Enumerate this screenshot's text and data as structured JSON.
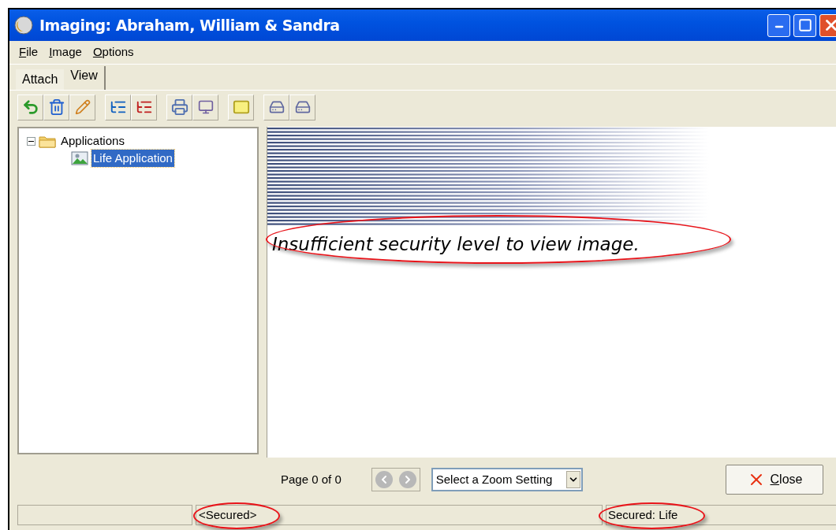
{
  "window": {
    "title": "Imaging: Abraham, William & Sandra"
  },
  "menu": [
    "File",
    "Image",
    "Options"
  ],
  "tabs": [
    {
      "label": "Attach",
      "selected": false
    },
    {
      "label": "View",
      "selected": true
    }
  ],
  "tree": [
    {
      "label": "Applications",
      "expanded": true,
      "children": [
        {
          "label": "Life Application",
          "selected": true
        }
      ]
    }
  ],
  "viewer": {
    "message": "Insufficient security level to view image."
  },
  "pager": {
    "label": "Page 0 of 0"
  },
  "zoom_select": {
    "value": "Select a Zoom Setting"
  },
  "close_button": {
    "label": "Close"
  },
  "status_bar": {
    "panel_2": "<Secured>",
    "panel_3": "Secured: Life"
  }
}
